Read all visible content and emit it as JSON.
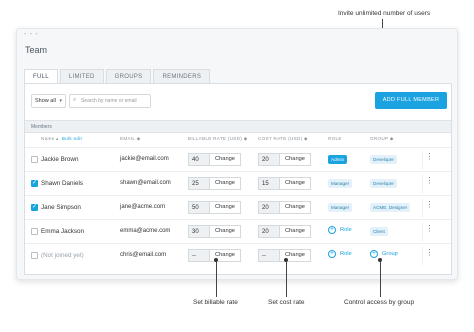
{
  "callouts": {
    "invite": "Invite unlimited number of users",
    "billable": "Set billable rate",
    "cost": "Set cost rate",
    "access": "Control access by group"
  },
  "window": {
    "dots": "• • •",
    "title": "Team"
  },
  "tabs": [
    "FULL",
    "LIMITED",
    "GROUPS",
    "REMINDERS"
  ],
  "toolbar": {
    "show_value": "Show all",
    "search_placeholder": "Search by name or email",
    "add_button": "ADD FULL MEMBER"
  },
  "members_label": "Members",
  "columns": {
    "name": "Name",
    "bulk_edit": "Bulk edit",
    "email": "EMAIL",
    "billable": "BILLABLE RATE (USD)",
    "cost": "COST RATE (USD)",
    "role": "ROLE",
    "group": "GROUP"
  },
  "rows": [
    {
      "checked": false,
      "name": "Jackie Brown",
      "email": "jackie@email.com",
      "billable": "40",
      "cost": "20",
      "role": "Admin",
      "group": "Developer"
    },
    {
      "checked": true,
      "name": "Shawn Daniels",
      "email": "shawn@email.com",
      "billable": "25",
      "cost": "15",
      "role": "Manager",
      "group": "Developer"
    },
    {
      "checked": true,
      "name": "Jane Simpson",
      "email": "jane@acme.com",
      "billable": "50",
      "cost": "20",
      "role": "Manager",
      "group": "ACME, Designer"
    },
    {
      "checked": false,
      "name": "Emma Jackson",
      "email": "emma@acme.com",
      "billable": "30",
      "cost": "20",
      "role": "+ Role",
      "group": "Client"
    },
    {
      "checked": false,
      "name": "(Not joined yet)",
      "email": "chris@email.com",
      "billable": "--",
      "cost": "--",
      "role": "+ Role",
      "group": "+ Group"
    }
  ],
  "change_label": "Change",
  "role_add": "Role",
  "group_add": "Group",
  "colors": {
    "accent": "#1aa3e0"
  }
}
